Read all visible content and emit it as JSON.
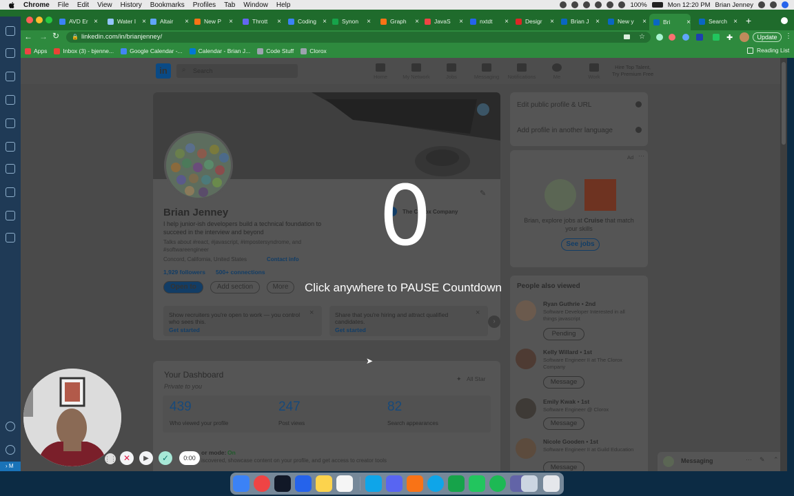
{
  "menubar": {
    "app": "Chrome",
    "items": [
      "File",
      "Edit",
      "View",
      "History",
      "Bookmarks",
      "Profiles",
      "Tab",
      "Window",
      "Help"
    ],
    "battery": "100%",
    "clock": "Mon 12:20 PM",
    "user": "Brian Jenney"
  },
  "tabs": [
    {
      "label": "AVD Er",
      "color": "#3b82f6"
    },
    {
      "label": "Water I",
      "color": "#93c5fd"
    },
    {
      "label": "Altair",
      "color": "#60a5fa"
    },
    {
      "label": "New P",
      "color": "#f97316"
    },
    {
      "label": "Thrott",
      "color": "#6366f1"
    },
    {
      "label": "Coding",
      "color": "#3b82f6"
    },
    {
      "label": "Synon",
      "color": "#16a34a"
    },
    {
      "label": "Graph",
      "color": "#f97316"
    },
    {
      "label": "JavaS",
      "color": "#ef4444"
    },
    {
      "label": "nxtdt",
      "color": "#2563eb"
    },
    {
      "label": "Desigr",
      "color": "#dc2626"
    },
    {
      "label": "Brian J",
      "color": "#0a66c2"
    },
    {
      "label": "New y",
      "color": "#0a66c2"
    },
    {
      "label": "Bri",
      "color": "#0a66c2",
      "active": true
    },
    {
      "label": "Search",
      "color": "#0a66c2"
    }
  ],
  "toolbar": {
    "url": "linkedin.com/in/brianjenney/",
    "update": "Update"
  },
  "bookmarks": [
    {
      "label": "Apps",
      "color": "#ef4444"
    },
    {
      "label": "Inbox (3) - bjenne...",
      "color": "#ea4335"
    },
    {
      "label": "Google Calendar -...",
      "color": "#4285f4"
    },
    {
      "label": "Calendar - Brian J...",
      "color": "#0078d4"
    },
    {
      "label": "Code Stuff",
      "color": "#9ca3af"
    },
    {
      "label": "Clorox",
      "color": "#9ca3af"
    }
  ],
  "reading_list": "Reading List",
  "linkedin": {
    "logo": "in",
    "search_placeholder": "Search",
    "nav": [
      "Home",
      "My Network",
      "Jobs",
      "Messaging",
      "Notifications",
      "Me",
      "Work"
    ],
    "premium": [
      "Hire Top Talent,",
      "Try Premium Free"
    ],
    "name": "Brian Jenney",
    "headline": [
      "I help junior-ish developers build a technical foundation to",
      "succeed in the interview and beyond"
    ],
    "talks": [
      "Talks about #react, #javascript, #impostersyndrome, and",
      "#softwareengineer"
    ],
    "location": "Concord, California, United States",
    "contact": "Contact info",
    "followers": "1,929 followers",
    "connections": "500+ connections",
    "company": "The Clorox Company",
    "buttons": {
      "open": "Open to",
      "add": "Add section",
      "more": "More"
    },
    "promo": [
      {
        "title": "Show recruiters you're open to work — you control who sees this.",
        "link": "Get started"
      },
      {
        "title": "Share that you're hiring and attract qualified candidates.",
        "link": "Get started"
      }
    ],
    "dashboard": {
      "title": "Your Dashboard",
      "subtitle": "Private to you",
      "star": "All Star",
      "stats": [
        {
          "value": "439",
          "label": "Who viewed your profile"
        },
        {
          "value": "247",
          "label": "Post views"
        },
        {
          "value": "82",
          "label": "Search appearances"
        }
      ],
      "creator_label": "or mode:",
      "creator_value": "On",
      "creator_text": "iscovered, showcase content on your profile, and get access to creator tools"
    },
    "sidebar_links": [
      "Edit public profile & URL",
      "Add profile in another language"
    ],
    "ad": {
      "label": "Ad",
      "text_prefix": "Brian, explore jobs at",
      "company": "Cruise",
      "text_suffix": "that match",
      "line2": "your skills",
      "button": "See jobs"
    },
    "people_title": "People also viewed",
    "people": [
      {
        "name": "Ryan Guthrie",
        "degree": "2nd",
        "headline": "Software Developer Interested in all things javascript",
        "button": "Pending"
      },
      {
        "name": "Kelly Willard",
        "degree": "1st",
        "headline": "Software Engineer II at The Clorox Company",
        "button": "Message"
      },
      {
        "name": "Emily Kwak",
        "degree": "1st",
        "headline": "Software Engineer @ Clorox",
        "button": "Message"
      },
      {
        "name": "Nicole Gooden",
        "degree": "1st",
        "headline": "Software Engineer II at Guild Education",
        "button": "Message"
      }
    ],
    "messaging": "Messaging"
  },
  "overlay": {
    "count": "0",
    "message": "Click anywhere to PAUSE Countdown"
  },
  "recorder": {
    "timer": "0:00"
  },
  "dock": [
    {
      "name": "finder-icon",
      "color": "#3b82f6"
    },
    {
      "name": "chrome-icon",
      "color": "#ef4444"
    },
    {
      "name": "terminal-icon",
      "color": "#111827"
    },
    {
      "name": "vscode-icon",
      "color": "#2563eb"
    },
    {
      "name": "notes-icon",
      "color": "#fcd34d"
    },
    {
      "name": "slack-icon",
      "color": "#f5f5f5"
    },
    {
      "name": "outlook-icon",
      "color": "#0ea5e9"
    },
    {
      "name": "discord-icon",
      "color": "#5865f2"
    },
    {
      "name": "postman-icon",
      "color": "#f97316"
    },
    {
      "name": "safari-icon",
      "color": "#0ea5e9"
    },
    {
      "name": "mongodb-icon",
      "color": "#16a34a"
    },
    {
      "name": "gitkraken-icon",
      "color": "#22c55e"
    },
    {
      "name": "spotify-icon",
      "color": "#1db954"
    },
    {
      "name": "teams-icon",
      "color": "#6264a7"
    },
    {
      "name": "downloads-icon",
      "color": "#cbd5e1"
    },
    {
      "name": "trash-icon",
      "color": "#e5e7eb"
    }
  ]
}
